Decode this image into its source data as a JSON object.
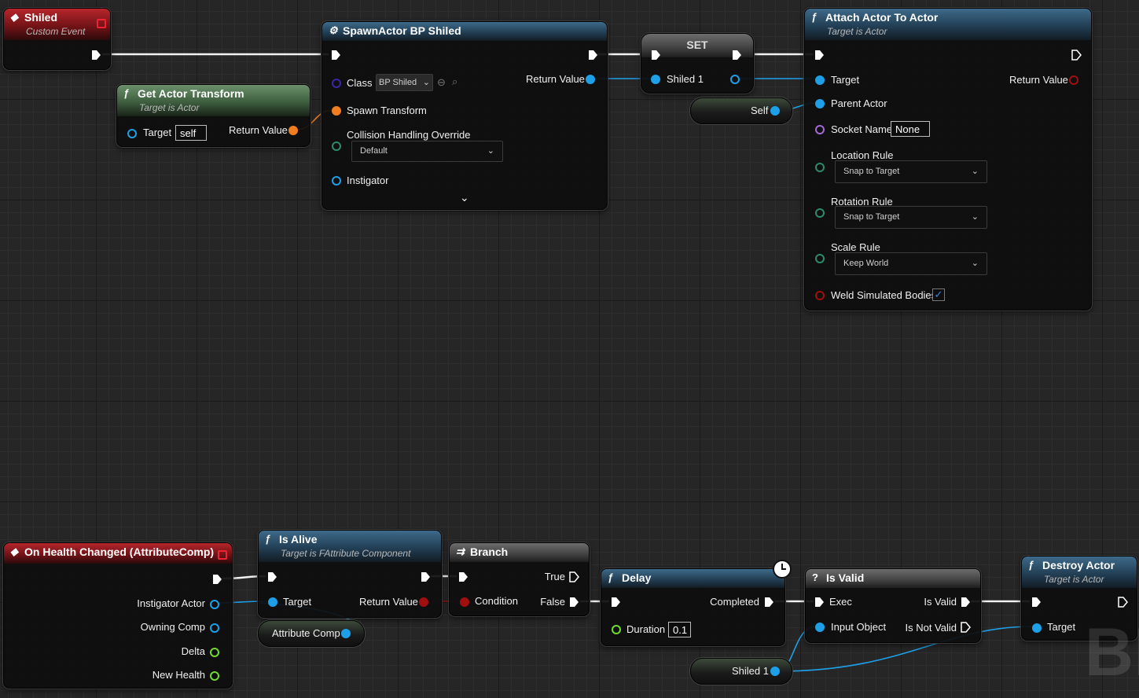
{
  "shiled_event": {
    "title": "Shiled",
    "subtitle": "Custom Event"
  },
  "get_actor_transform": {
    "title": "Get Actor Transform",
    "subtitle": "Target is Actor",
    "target_label": "Target",
    "target_value": "self",
    "return_label": "Return Value"
  },
  "spawn_actor": {
    "title": "SpawnActor BP Shiled",
    "class_label": "Class",
    "class_value": "BP Shiled",
    "spawn_transform_label": "Spawn Transform",
    "collision_label": "Collision Handling Override",
    "collision_value": "Default",
    "instigator_label": "Instigator",
    "return_label": "Return Value"
  },
  "set_node": {
    "title": "SET",
    "var_label": "Shiled 1"
  },
  "self_node": {
    "label": "Self"
  },
  "attach_node": {
    "title": "Attach Actor To Actor",
    "subtitle": "Target is Actor",
    "target_label": "Target",
    "return_label": "Return Value",
    "parent_label": "Parent Actor",
    "socket_label": "Socket Name",
    "socket_value": "None",
    "location_label": "Location Rule",
    "location_value": "Snap to Target",
    "rotation_label": "Rotation Rule",
    "rotation_value": "Snap to Target",
    "scale_label": "Scale Rule",
    "scale_value": "Keep World",
    "weld_label": "Weld Simulated Bodies",
    "weld_checked": true
  },
  "health_event": {
    "title": "On Health Changed (AttributeComp)",
    "pins": [
      "Instigator Actor",
      "Owning Comp",
      "Delta",
      "New Health"
    ]
  },
  "is_alive": {
    "title": "Is Alive",
    "subtitle": "Target is FAttribute Component",
    "target_label": "Target",
    "return_label": "Return Value"
  },
  "attribute_comp": {
    "label": "Attribute Comp"
  },
  "branch": {
    "title": "Branch",
    "condition_label": "Condition",
    "true_label": "True",
    "false_label": "False"
  },
  "delay": {
    "title": "Delay",
    "completed_label": "Completed",
    "duration_label": "Duration",
    "duration_value": "0.1"
  },
  "is_valid": {
    "title": "Is Valid",
    "exec_label": "Exec",
    "input_label": "Input Object",
    "valid_label": "Is Valid",
    "not_valid_label": "Is Not Valid"
  },
  "shiled_var": {
    "label": "Shiled 1"
  },
  "destroy_actor": {
    "title": "Destroy Actor",
    "subtitle": "Target is Actor",
    "target_label": "Target"
  },
  "watermark": {
    "text": "BL"
  }
}
